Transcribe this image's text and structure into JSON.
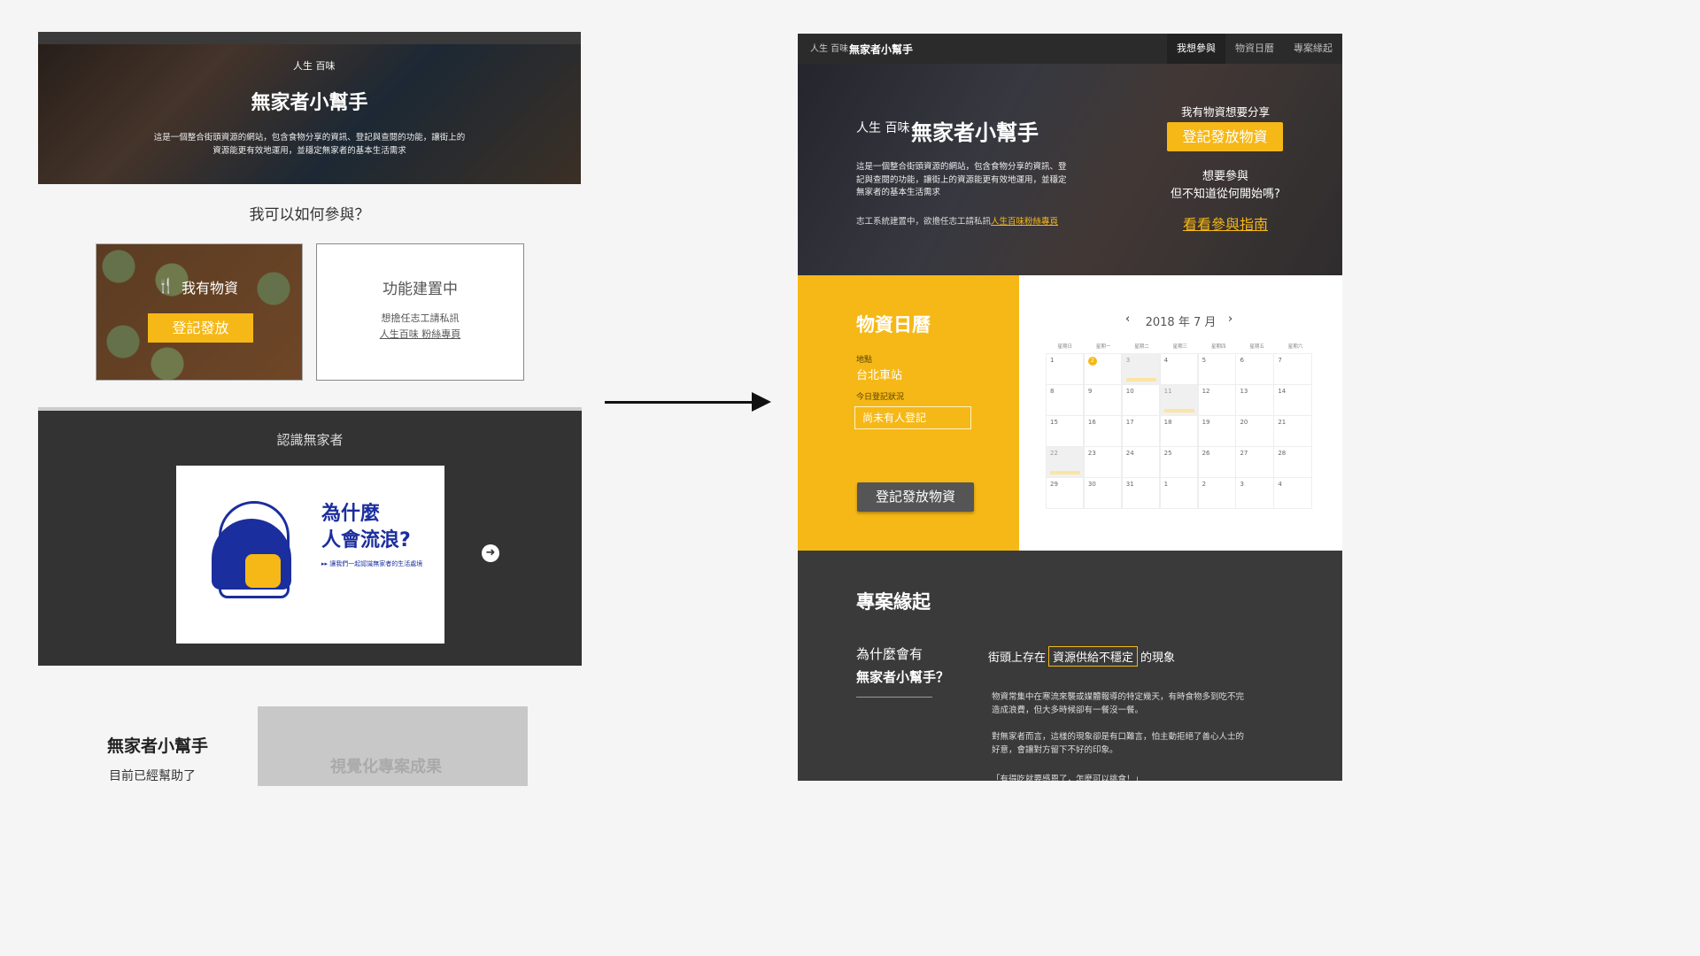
{
  "old": {
    "hero": {
      "logo": "人生 百味",
      "title": "無家者小幫手",
      "desc": "這是一個整合街頭資源的網站，包含食物分享的資訊、登記與查閱的功能，讓街上的資源能更有效地運用，並穩定無家者的基本生活需求"
    },
    "how_title": "我可以如何參與？",
    "card_food": {
      "icon": "fork-knife-icon",
      "label": "我有物資",
      "button": "登記發放"
    },
    "card_wip": {
      "title": "功能建置中",
      "line1": "想擔任志工請私訊",
      "line2": "人生百味 粉絲專頁"
    },
    "know": {
      "title": "認識無家者",
      "poster_title1": "為什麼",
      "poster_title2": "人會流浪?",
      "poster_sub": "▸▸ 讓我們一起認識無家者的生活處境",
      "next_icon": "arrow-right-circle-icon"
    },
    "bottom": {
      "title": "無家者小幫手",
      "sub": "目前已經幫助了",
      "placeholder": "視覺化專案成果"
    }
  },
  "new": {
    "nav": {
      "logo": "人生 百味",
      "brand": "無家者小幫手",
      "items": [
        "我想參與",
        "物資日曆",
        "專案緣起"
      ]
    },
    "hero": {
      "logo": "人生 百味",
      "title": "無家者小幫手",
      "desc": "這是一個整合街頭資源的網站，包含食物分享的資訊、登記與查閱的功能，讓街上的資源能更有效地運用，並穩定無家者的基本生活需求",
      "note_prefix": "志工系統建置中，欲擔任志工請私訊",
      "note_link": "人生百味粉絲專頁",
      "share_q": "我有物資想要分享",
      "share_btn": "登記發放物資",
      "join_q1": "想要參與",
      "join_q2": "但不知道從何開始嗎?",
      "guide": "看看參與指南"
    },
    "calendar_panel": {
      "title": "物資日曆",
      "loc_label": "地點",
      "loc_value": "台北車站",
      "status_label": "今日登記狀況",
      "status_value": "尚未有人登記",
      "button": "登記發放物資"
    },
    "calendar": {
      "month": "2018 年 7 月",
      "prev_icon": "chevron-left-icon",
      "next_icon": "chevron-right-icon",
      "weekdays": [
        "星期日",
        "星期一",
        "星期二",
        "星期三",
        "星期四",
        "星期五",
        "星期六"
      ],
      "weeks": [
        [
          "1",
          "2",
          "3",
          "4",
          "5",
          "6",
          "7"
        ],
        [
          "8",
          "9",
          "10",
          "11",
          "12",
          "13",
          "14"
        ],
        [
          "15",
          "16",
          "17",
          "18",
          "19",
          "20",
          "21"
        ],
        [
          "22",
          "23",
          "24",
          "25",
          "26",
          "27",
          "28"
        ],
        [
          "29",
          "30",
          "31",
          "1",
          "2",
          "3",
          "4"
        ]
      ],
      "today": "2"
    },
    "origin": {
      "title": "專案緣起",
      "q1": "為什麼會有",
      "q2": "無家者小幫手？",
      "line_prefix": "街頭上存在",
      "line_highlight": "資源供給不穩定",
      "line_suffix": "的現象",
      "p1": "物資常集中在寒流來襲或媒體報導的特定幾天，有時食物多到吃不完造成浪費，但大多時候卻有一餐沒一餐。",
      "p2": "對無家者而言，這樣的現象卻是有口難言，怕主動拒絕了善心人士的好意，會讓對方留下不好的印象。",
      "p3": "「有得吃就要感恩了，怎麼可以挑食！」"
    }
  },
  "colors": {
    "accent": "#f6b817",
    "dark": "#333333"
  }
}
